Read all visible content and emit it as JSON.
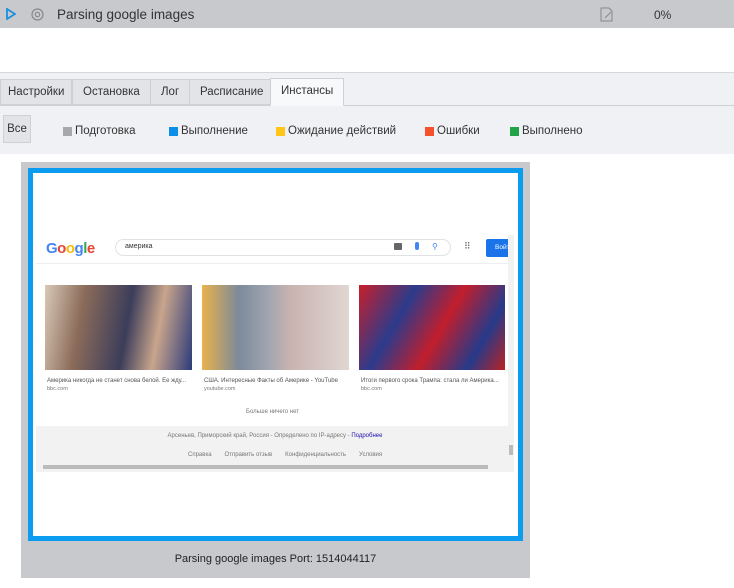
{
  "header": {
    "title": "Parsing google images",
    "progress": "0%"
  },
  "tabs": [
    {
      "label": "Настройки"
    },
    {
      "label": "Остановка"
    },
    {
      "label": "Лог"
    },
    {
      "label": "Расписание"
    },
    {
      "label": "Инстансы"
    }
  ],
  "filters": [
    {
      "label": "Все"
    },
    {
      "label": "Подготовка",
      "color": "#a8a8ac"
    },
    {
      "label": "Выполнение",
      "color": "#0b8fe8"
    },
    {
      "label": "Ожидание действий",
      "color": "#ffc617"
    },
    {
      "label": "Ошибки",
      "color": "#f4512c"
    },
    {
      "label": "Выполнено",
      "color": "#21a347"
    }
  ],
  "browser": {
    "logo": "Google",
    "query": "америка",
    "signin": "Войти",
    "results": [
      {
        "title": "Америка никогда не станет снова белой. Ее жду...",
        "source": "bbc.com"
      },
      {
        "title": "США. Интересные Факты об Америке - YouTube",
        "source": "youtube.com"
      },
      {
        "title": "Итоги первого срока Трампа: стала ли Америка...",
        "source": "bbc.com"
      }
    ],
    "no_more": "Больше ничего нет",
    "location": "Арсеньев, Приморский край, Россия - Определено по IP-адресу - ",
    "location_link": "Подробнее",
    "footer_links": [
      "Справка",
      "Отправить отзыв",
      "Конфиденциальность",
      "Условия"
    ]
  },
  "caption": "Parsing google images Port: 1514044117"
}
